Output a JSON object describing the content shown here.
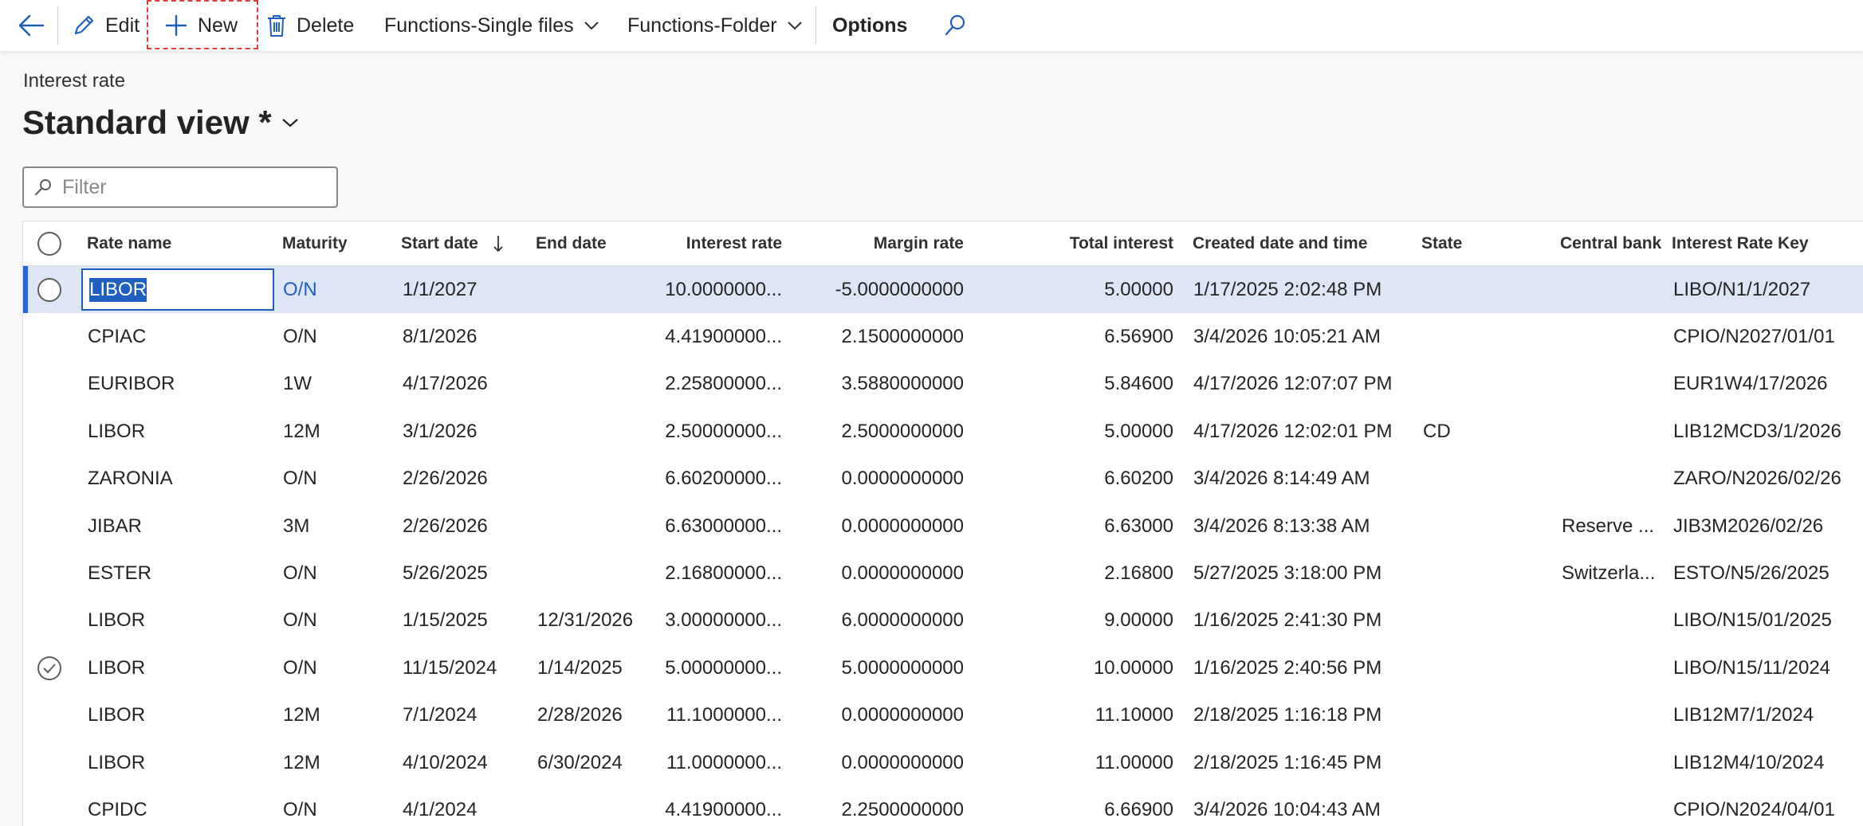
{
  "toolbar": {
    "back": "Back",
    "edit": "Edit",
    "new": "New",
    "delete": "Delete",
    "functions_single": "Functions-Single files",
    "functions_folder": "Functions-Folder",
    "options": "Options"
  },
  "page": {
    "caption": "Interest rate",
    "view_title": "Standard view *"
  },
  "filter": {
    "placeholder": "Filter",
    "value": ""
  },
  "grid": {
    "columns": [
      "Rate name",
      "Maturity",
      "Start date",
      "End date",
      "Interest rate",
      "Margin rate",
      "Total interest",
      "Created date and time",
      "State",
      "Central bank",
      "Interest Rate Key"
    ],
    "sort_column": "Start date",
    "sort_direction": "descending",
    "selected_row": 0,
    "checked_row": 8,
    "rows": [
      {
        "rate_name": "LIBOR",
        "maturity": "O/N",
        "start_date": "1/1/2027",
        "end_date": "",
        "interest_rate": "10.0000000...",
        "margin_rate": "-5.0000000000",
        "total_interest": "5.00000",
        "created": "1/17/2025 2:02:48 PM",
        "state": "",
        "central_bank": "",
        "key": "LIBO/N1/1/2027"
      },
      {
        "rate_name": "CPIAC",
        "maturity": "O/N",
        "start_date": "8/1/2026",
        "end_date": "",
        "interest_rate": "4.41900000...",
        "margin_rate": "2.1500000000",
        "total_interest": "6.56900",
        "created": "3/4/2026 10:05:21 AM",
        "state": "",
        "central_bank": "",
        "key": "CPIO/N2027/01/01"
      },
      {
        "rate_name": "EURIBOR",
        "maturity": "1W",
        "start_date": "4/17/2026",
        "end_date": "",
        "interest_rate": "2.25800000...",
        "margin_rate": "3.5880000000",
        "total_interest": "5.84600",
        "created": "4/17/2026 12:07:07 PM",
        "state": "",
        "central_bank": "",
        "key": "EUR1W4/17/2026"
      },
      {
        "rate_name": "LIBOR",
        "maturity": "12M",
        "start_date": "3/1/2026",
        "end_date": "",
        "interest_rate": "2.50000000...",
        "margin_rate": "2.5000000000",
        "total_interest": "5.00000",
        "created": "4/17/2026 12:02:01 PM",
        "state": "CD",
        "central_bank": "",
        "key": "LIB12MCD3/1/2026"
      },
      {
        "rate_name": "ZARONIA",
        "maturity": "O/N",
        "start_date": "2/26/2026",
        "end_date": "",
        "interest_rate": "6.60200000...",
        "margin_rate": "0.0000000000",
        "total_interest": "6.60200",
        "created": "3/4/2026 8:14:49 AM",
        "state": "",
        "central_bank": "",
        "key": "ZARO/N2026/02/26"
      },
      {
        "rate_name": "JIBAR",
        "maturity": "3M",
        "start_date": "2/26/2026",
        "end_date": "",
        "interest_rate": "6.63000000...",
        "margin_rate": "0.0000000000",
        "total_interest": "6.63000",
        "created": "3/4/2026 8:13:38 AM",
        "state": "",
        "central_bank": "Reserve ...",
        "key": "JIB3M2026/02/26"
      },
      {
        "rate_name": "ESTER",
        "maturity": "O/N",
        "start_date": "5/26/2025",
        "end_date": "",
        "interest_rate": "2.16800000...",
        "margin_rate": "0.0000000000",
        "total_interest": "2.16800",
        "created": "5/27/2025 3:18:00 PM",
        "state": "",
        "central_bank": "Switzerla...",
        "key": "ESTO/N5/26/2025"
      },
      {
        "rate_name": "LIBOR",
        "maturity": "O/N",
        "start_date": "1/15/2025",
        "end_date": "12/31/2026",
        "interest_rate": "3.00000000...",
        "margin_rate": "6.0000000000",
        "total_interest": "9.00000",
        "created": "1/16/2025 2:41:30 PM",
        "state": "",
        "central_bank": "",
        "key": "LIBO/N15/01/2025"
      },
      {
        "rate_name": "LIBOR",
        "maturity": "O/N",
        "start_date": "11/15/2024",
        "end_date": "1/14/2025",
        "interest_rate": "5.00000000...",
        "margin_rate": "5.0000000000",
        "total_interest": "10.00000",
        "created": "1/16/2025 2:40:56 PM",
        "state": "",
        "central_bank": "",
        "key": "LIBO/N15/11/2024"
      },
      {
        "rate_name": "LIBOR",
        "maturity": "12M",
        "start_date": "7/1/2024",
        "end_date": "2/28/2026",
        "interest_rate": "11.1000000...",
        "margin_rate": "0.0000000000",
        "total_interest": "11.10000",
        "created": "2/18/2025 1:16:18 PM",
        "state": "",
        "central_bank": "",
        "key": "LIB12M7/1/2024"
      },
      {
        "rate_name": "LIBOR",
        "maturity": "12M",
        "start_date": "4/10/2024",
        "end_date": "6/30/2024",
        "interest_rate": "11.0000000...",
        "margin_rate": "0.0000000000",
        "total_interest": "11.00000",
        "created": "2/18/2025 1:16:45 PM",
        "state": "",
        "central_bank": "",
        "key": "LIB12M4/10/2024"
      },
      {
        "rate_name": "CPIDC",
        "maturity": "O/N",
        "start_date": "4/1/2024",
        "end_date": "",
        "interest_rate": "4.41900000...",
        "margin_rate": "2.2500000000",
        "total_interest": "6.66900",
        "created": "3/4/2026 10:04:43 AM",
        "state": "",
        "central_bank": "",
        "key": "CPIO/N2024/04/01"
      }
    ]
  },
  "colors": {
    "accent": "#1f5fbf",
    "selected_row": "#dce6f7",
    "highlight_box": "#e03a3a"
  }
}
